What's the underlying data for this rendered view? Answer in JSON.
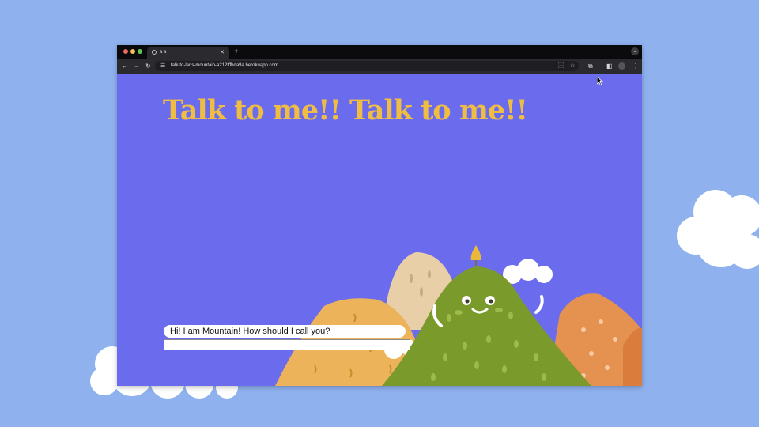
{
  "browser": {
    "tab_title": "a a",
    "tab_close_icon": "close-icon",
    "new_tab_label": "+",
    "tab_menu_label": "⌄",
    "url": "talk-to-lans-mountain-a212fffbda9a.herokuapp.com",
    "back_label": "←",
    "forward_label": "→",
    "reload_label": "↻",
    "translate_label": "⿱",
    "bookmark_label": "☆",
    "extensions_label": "⧉",
    "sidepanel_label": "◧",
    "menu_label": "⋮",
    "traffic_colors": [
      "#ed6a5e",
      "#f5bf4f",
      "#61c554"
    ]
  },
  "page": {
    "heading": "Talk to me!! Talk to me!!",
    "bubble_text": "Hi! I am Mountain! How should I call you?",
    "input_value": "",
    "input_placeholder": ""
  },
  "colors": {
    "desktop": "#8fb1ee",
    "page_bg": "#6b6ced",
    "heading": "#f0bd43",
    "green_mountain": "#7a9a2c",
    "orange_mountain": "#e59150",
    "yellow_mountain": "#edb35a",
    "beige_mountain": "#e8cfa8"
  }
}
